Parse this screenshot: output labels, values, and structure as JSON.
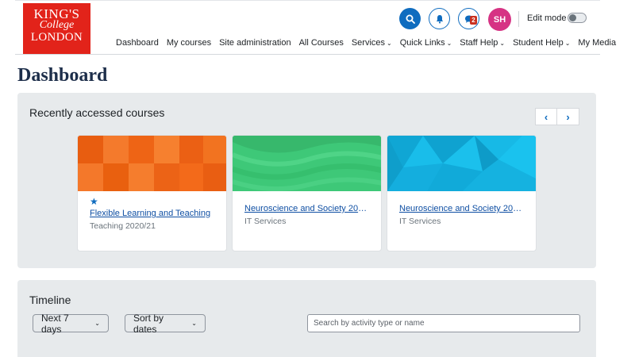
{
  "logo": {
    "line1": "KING'S",
    "line2": "College",
    "line3": "LONDON"
  },
  "nav": [
    {
      "label": "Dashboard",
      "dropdown": false
    },
    {
      "label": "My courses",
      "dropdown": false
    },
    {
      "label": "Site administration",
      "dropdown": false
    },
    {
      "label": "All Courses",
      "dropdown": false
    },
    {
      "label": "Services",
      "dropdown": true
    },
    {
      "label": "Quick Links",
      "dropdown": true
    },
    {
      "label": "Staff Help",
      "dropdown": true
    },
    {
      "label": "Student Help",
      "dropdown": true
    },
    {
      "label": "My Media",
      "dropdown": false
    }
  ],
  "header": {
    "search_icon": "search-icon",
    "notification_icon": "bell-icon",
    "message_icon": "chat-icon",
    "message_count": "2",
    "avatar_initials": "SH",
    "edit_mode_label": "Edit mode",
    "edit_mode_on": false
  },
  "page": {
    "title": "Dashboard"
  },
  "recent": {
    "title": "Recently accessed courses",
    "prev_icon": "chevron-left-icon",
    "next_icon": "chevron-right-icon",
    "courses": [
      {
        "name": "Flexible Learning and Teaching",
        "category": "Teaching 2020/21",
        "starred": true,
        "pattern": "orange-squares",
        "color": "#f26b1d"
      },
      {
        "name": "Neuroscience and Society 2022…",
        "category": "IT Services",
        "starred": false,
        "pattern": "green-waves",
        "color": "#3ec878"
      },
      {
        "name": "Neuroscience and Society 2022…",
        "category": "IT Services",
        "starred": false,
        "pattern": "blue-triangles",
        "color": "#13b5e3"
      }
    ]
  },
  "timeline": {
    "title": "Timeline",
    "date_filter": "Next 7 days",
    "sort_filter": "Sort by dates",
    "search_placeholder": "Search by activity type or name"
  },
  "colors": {
    "brand": "#e2231a",
    "primary": "#0f6cbf",
    "avatar": "#d63384",
    "block_bg": "#e7eaec"
  }
}
